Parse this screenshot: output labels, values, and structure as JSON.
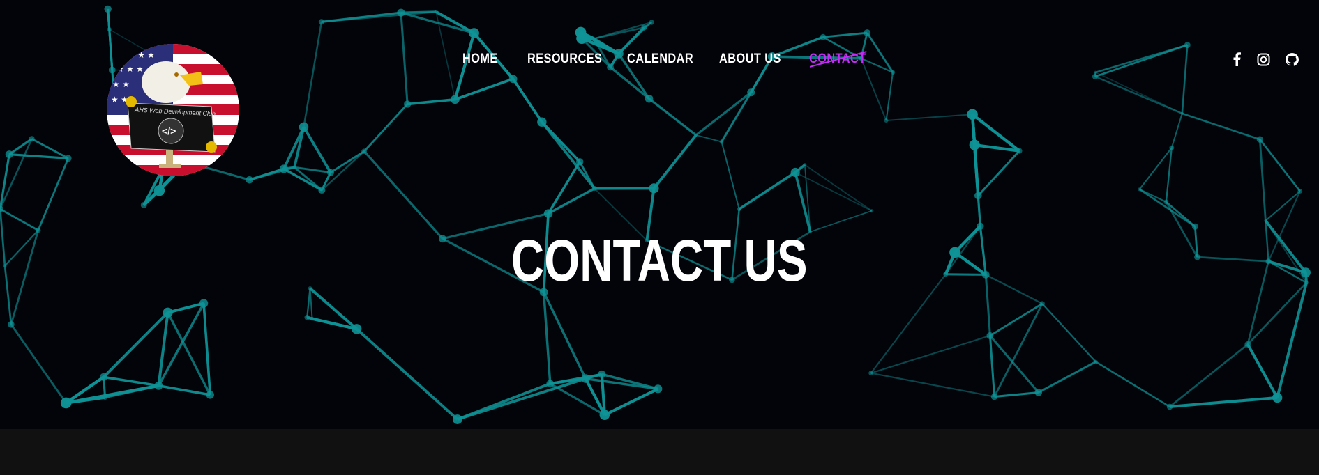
{
  "logo": {
    "alt_text": "AHS Web Development Club",
    "symbol": "</>"
  },
  "nav": {
    "items": [
      {
        "label": "HOME",
        "active": false
      },
      {
        "label": "RESOURCES",
        "active": false
      },
      {
        "label": "CALENDAR",
        "active": false
      },
      {
        "label": "ABOUT US",
        "active": false
      },
      {
        "label": "CONTACT",
        "active": true
      }
    ]
  },
  "social": [
    "facebook-icon",
    "instagram-icon",
    "github-icon"
  ],
  "hero": {
    "title": "CONTACT US"
  },
  "colors": {
    "accent": "#c32cf4",
    "network": "#0f9396",
    "background": "#03040a",
    "band": "#111111"
  }
}
